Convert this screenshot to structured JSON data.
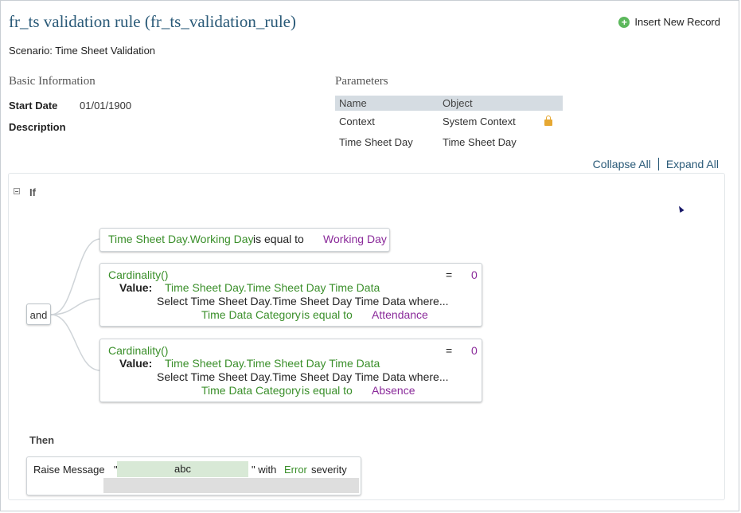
{
  "header": {
    "title": "fr_ts validation rule (fr_ts_validation_rule)",
    "insert_label": "Insert New Record",
    "scenario": "Scenario: Time Sheet Validation"
  },
  "basic_info": {
    "heading": "Basic Information",
    "start_date_label": "Start Date",
    "start_date_value": "01/01/1900",
    "description_label": "Description"
  },
  "parameters": {
    "heading": "Parameters",
    "columns": [
      "Name",
      "Object"
    ],
    "rows": [
      {
        "name": "Context",
        "object": "System Context",
        "locked": true
      },
      {
        "name": "Time Sheet Day",
        "object": "Time Sheet Day",
        "locked": false
      }
    ]
  },
  "links": {
    "collapse_all": "Collapse All",
    "expand_all": "Expand All"
  },
  "rule": {
    "if_label": "If",
    "and_label": "and",
    "condition1": {
      "left": "Time Sheet Day.Working Day",
      "op": "is equal to",
      "right": "Working Day"
    },
    "condition2": {
      "func": "Cardinality()",
      "eq": "=",
      "eq_value": "0",
      "value_label": "Value:",
      "value": "Time Sheet Day.Time Sheet Day Time Data",
      "select": "Select Time Sheet Day.Time Sheet Day Time Data where...",
      "where_field": "Time Data Category",
      "where_op": "is equal to",
      "where_value": "Attendance"
    },
    "condition3": {
      "func": "Cardinality()",
      "eq": "=",
      "eq_value": "0",
      "value_label": "Value:",
      "value": "Time Sheet Day.Time Sheet Day Time Data",
      "select": "Select Time Sheet Day.Time Sheet Day Time Data where...",
      "where_field": "Time Data Category",
      "where_op": "is equal to",
      "where_value": "Absence"
    },
    "then_label": "Then",
    "action": {
      "prefix": "Raise Message",
      "open_quote": "\"",
      "message": "abc",
      "close_quote": "\" with",
      "severity": "Error",
      "suffix": "severity"
    }
  },
  "colors": {
    "title": "#2a5a78",
    "green": "#3a8f2a",
    "purple": "#8a2a9a"
  }
}
